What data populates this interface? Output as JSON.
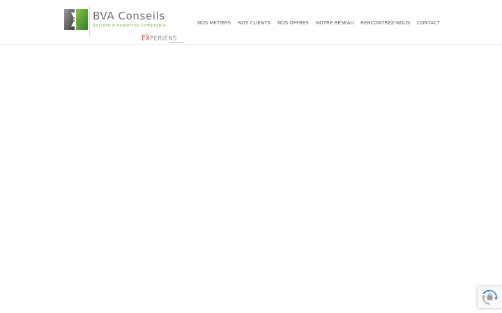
{
  "logo": {
    "name": "BVA Conseils",
    "tagline": "Société d'expertise comptable",
    "partner": {
      "top": "membre",
      "name_accent": "EX",
      "name_rest": "PERIENS",
      "sub": "réseau d'experts"
    }
  },
  "nav": {
    "items": [
      {
        "label": "NOS METIERS"
      },
      {
        "label": "NOS CLIENTS"
      },
      {
        "label": "NOS OFFRES"
      },
      {
        "label": "NOTRE RESEAU"
      },
      {
        "label": "RENCONTREZ-NOUS"
      },
      {
        "label": "CONTACT"
      }
    ]
  },
  "colors": {
    "logo_green": "#6aa535",
    "logo_dark_green": "#2e7d32",
    "partner_red": "#c0392b",
    "nav_text": "#5f5f5f",
    "divider": "#e6e6e6"
  },
  "recaptcha": {
    "icon": "recaptcha-icon"
  }
}
